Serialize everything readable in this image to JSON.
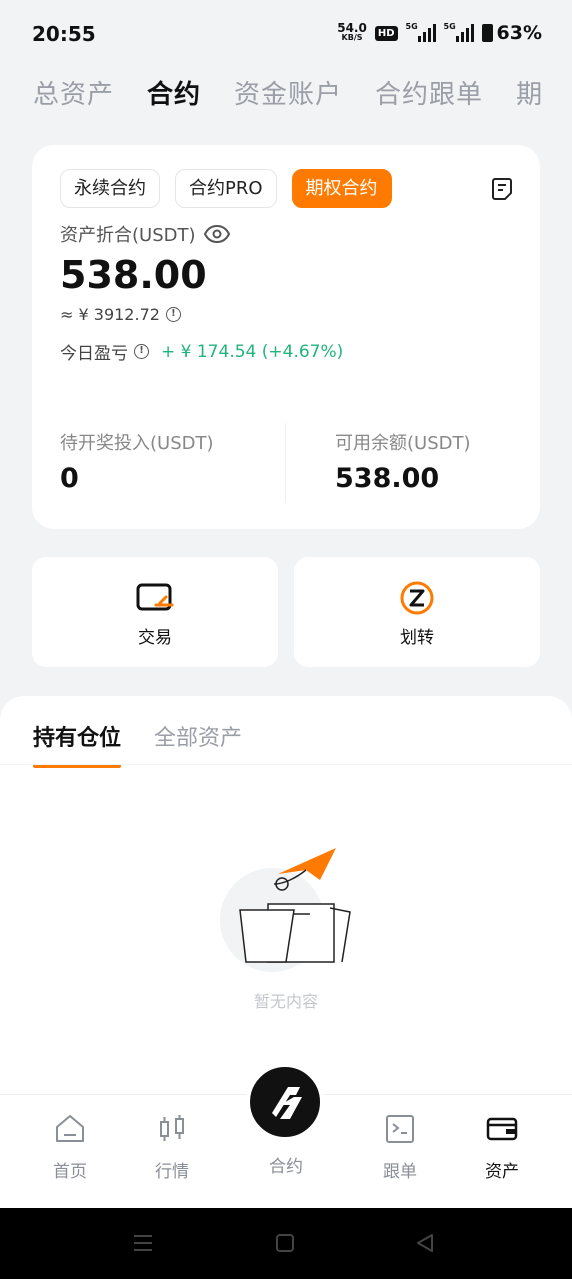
{
  "status_bar": {
    "time": "20:55",
    "net_speed": "54.0",
    "net_unit": "KB/S",
    "hd": "HD",
    "sig1_label": "5G",
    "sig2_label": "5G",
    "battery": "63%"
  },
  "top_tabs": [
    "总资产",
    "合约",
    "资金账户",
    "合约跟单",
    "期"
  ],
  "card": {
    "chips": [
      "永续合约",
      "合约PRO",
      "期权合约"
    ],
    "balance_label": "资产折合(USDT)",
    "balance_value": "538.00",
    "approx": "≈ ¥ 3912.72",
    "pnl_label": "今日盈亏",
    "pnl_value": "+ ¥ 174.54 (+4.67%)",
    "pending_label": "待开奖投入(USDT)",
    "pending_value": "0",
    "available_label": "可用余额(USDT)",
    "available_value": "538.00"
  },
  "actions": {
    "trade": "交易",
    "transfer": "划转"
  },
  "positions": {
    "tabs": [
      "持有仓位",
      "全部资产"
    ],
    "empty_text": "暂无内容"
  },
  "bottom_nav": {
    "home": "首页",
    "market": "行情",
    "contract": "合约",
    "copy": "跟单",
    "assets": "资产"
  },
  "colors": {
    "accent": "#ff7a00",
    "profit": "#21b47d"
  }
}
